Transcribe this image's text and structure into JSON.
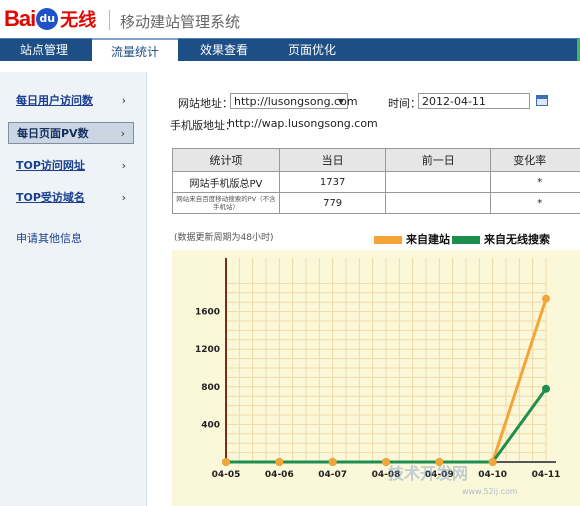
{
  "header": {
    "logo_text": "Bai",
    "logo_paw": "du",
    "logo_suffix": "无线",
    "title": "移动建站管理系统"
  },
  "nav": {
    "tabs": [
      {
        "label": "站点管理"
      },
      {
        "label": "流量统计"
      },
      {
        "label": "效果查看"
      },
      {
        "label": "页面优化"
      }
    ],
    "active_index": 1
  },
  "sidebar": {
    "items": [
      {
        "label": "每日用户访问数"
      },
      {
        "label": "每日页面PV数"
      },
      {
        "label": "TOP访问网址"
      },
      {
        "label": "TOP受访域名"
      }
    ],
    "active_index": 1,
    "link": "申请其他信息"
  },
  "filters": {
    "site_label": "网站地址：",
    "site_value": "http://lusongsong.com",
    "time_label": "时间：",
    "time_value": "2012-04-11",
    "mobile_label": "手机版地址：",
    "mobile_value": "http://wap.lusongsong.com"
  },
  "table": {
    "headers": [
      "统计项",
      "当日",
      "前一日",
      "变化率"
    ],
    "rows": [
      [
        "网站手机版总PV",
        "1737",
        "",
        "*"
      ],
      [
        "网站来自百度移动搜索的PV（不含手机站）",
        "779",
        "",
        "*"
      ]
    ]
  },
  "chart_note": "(数据更新周期为48小时)",
  "chart_data": {
    "type": "line",
    "x": [
      "04-05",
      "04-06",
      "04-07",
      "04-08",
      "04-09",
      "04-10",
      "04-11"
    ],
    "series": [
      {
        "name": "来自建站",
        "color": "#f5a43a",
        "values": [
          0,
          0,
          0,
          0,
          0,
          0,
          1737
        ]
      },
      {
        "name": "来自无线搜索",
        "color": "#1e8e4e",
        "values": [
          0,
          0,
          0,
          0,
          0,
          0,
          779
        ]
      }
    ],
    "yticks": [
      400,
      800,
      1200,
      1600
    ],
    "ylim": [
      0,
      2000
    ],
    "grid": true,
    "legend": "top-right"
  },
  "colors": {
    "nav_bg": "#1d4f86",
    "chart_bg": "#fbf8da",
    "axis": "#7a2e1a"
  },
  "watermark": {
    "main": "技术开发网",
    "sub": "www.52ij.com"
  }
}
